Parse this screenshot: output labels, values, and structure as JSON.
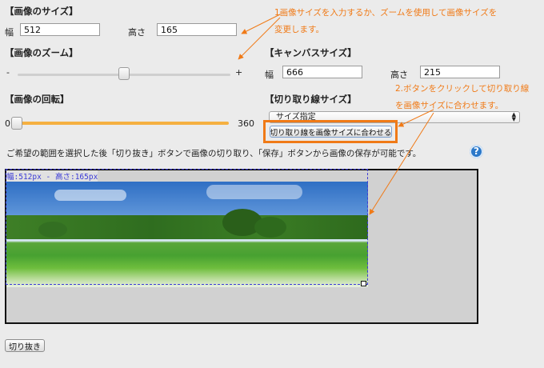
{
  "image_size": {
    "title": "【画像のサイズ】",
    "width_label": "幅",
    "width_value": "512",
    "height_label": "高さ",
    "height_value": "165"
  },
  "zoom": {
    "title": "【画像のズーム】",
    "minus_label": "-",
    "plus_label": "+",
    "level": 0.5
  },
  "rotation": {
    "title": "【画像の回転】",
    "min_label": "0",
    "max_label": "360",
    "value": 0
  },
  "canvas_size": {
    "title": "【キャンバスサイズ】",
    "width_label": "幅",
    "width_value": "666",
    "height_label": "高さ",
    "height_value": "215"
  },
  "crop_size": {
    "title": "【切り取り線サイズ】",
    "select_value": "サイズ指定",
    "fit_button_label": "切り取り線を画像サイズに合わせる"
  },
  "instructions": "ご希望の範囲を選択した後「切り抜き」ボタンで画像の切り取り、「保存」ボタンから画像の保存が可能です。",
  "help_icon_glyph": "?",
  "canvas": {
    "crop_size_label": "幅:512px - 高さ:165px"
  },
  "crop_button_label": "切り抜き",
  "annotations": {
    "note1_line1": "1画像サイズを入力するか、ズームを使用して画像サイズを",
    "note1_line2": "変更します。",
    "note2_line1": "2.ボタンをクリックして切り取り線",
    "note2_line2": "を画像サイズに合わせます。"
  },
  "colors": {
    "annotation": "#f07a17",
    "slider_fill": "#f5b041",
    "crop_outline": "#3b3bd6",
    "help_icon": "#2b78c9"
  },
  "icons": [
    "question-circle-icon",
    "resize-handle-icon",
    "select-arrows-icon"
  ]
}
